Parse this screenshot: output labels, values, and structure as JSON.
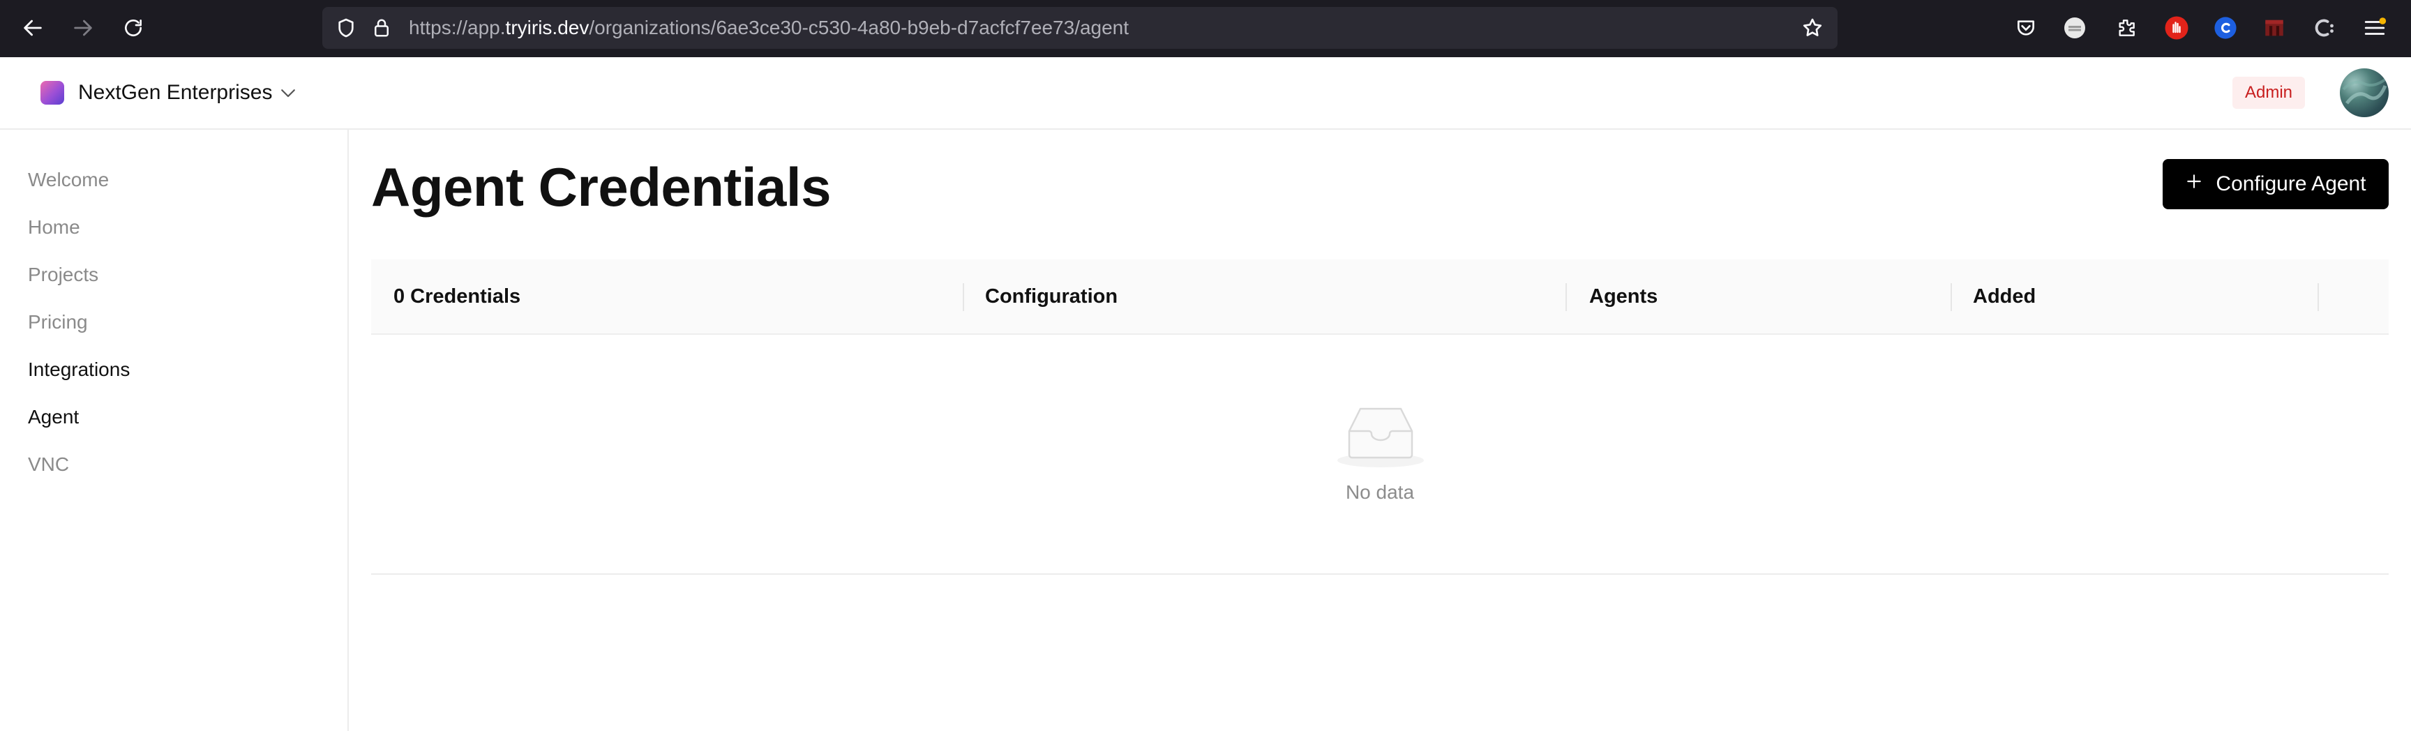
{
  "browser": {
    "url_prefix": "https://app.",
    "url_host": "tryiris.dev",
    "url_path": "/organizations/6ae3ce30-c530-4a80-b9eb-d7acfcf7ee73/agent",
    "icons": [
      "back-icon",
      "forward-icon",
      "reload-icon",
      "shield-icon",
      "lock-icon",
      "star-icon",
      "pocket-icon",
      "extension-icon",
      "puzzle-icon",
      "hand-stop-icon",
      "blue-circle-icon",
      "red-box-icon",
      "c-icon",
      "menu-icon"
    ]
  },
  "header": {
    "org_name": "NextGen Enterprises",
    "role_badge": "Admin",
    "colors": {
      "badge_bg": "#fdeeee",
      "badge_text": "#c81e1e"
    }
  },
  "sidebar": {
    "items": [
      {
        "label": "Welcome",
        "active": false
      },
      {
        "label": "Home",
        "active": false
      },
      {
        "label": "Projects",
        "active": false
      },
      {
        "label": "Pricing",
        "active": false
      },
      {
        "label": "Integrations",
        "active": true
      },
      {
        "label": "Agent",
        "active": true
      },
      {
        "label": "VNC",
        "active": false
      }
    ]
  },
  "main": {
    "title": "Agent Credentials",
    "configure_button": "Configure Agent",
    "table": {
      "columns": [
        "0 Credentials",
        "Configuration",
        "Agents",
        "Added"
      ],
      "empty_text": "No data"
    }
  }
}
